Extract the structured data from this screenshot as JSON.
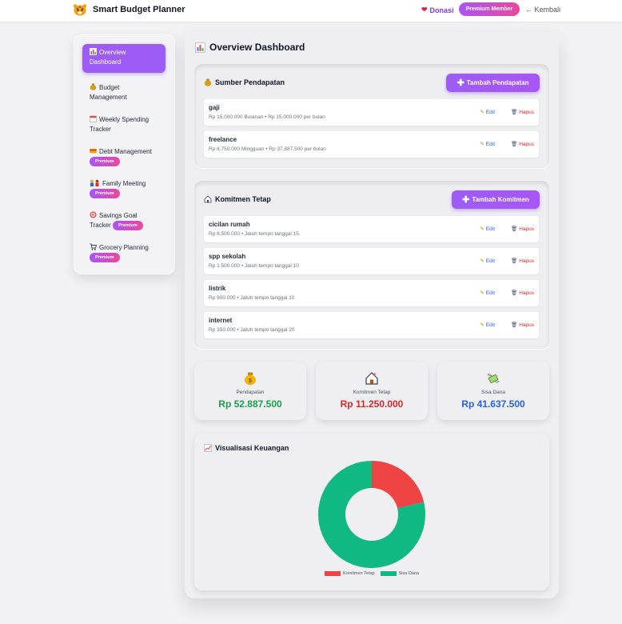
{
  "header": {
    "app_title": "Smart Budget Planner",
    "donasi_label": "Donasi",
    "premium_label": "Premium Member",
    "back_label": "← Kembali"
  },
  "sidebar": {
    "items": [
      {
        "label": "Overview Dashboard",
        "icon": "chart-icon",
        "active": true
      },
      {
        "label": "Budget Management",
        "icon": "money-bag-icon"
      },
      {
        "label": "Weekly Spending Tracker",
        "icon": "calendar-icon"
      },
      {
        "label": "Debt Management",
        "icon": "credit-card-icon",
        "badge": "Premium"
      },
      {
        "label": "Family Meeting",
        "icon": "family-icon",
        "badge": "Premium"
      },
      {
        "label": "Savings Goal Tracker",
        "icon": "target-icon",
        "badge": "Premium"
      },
      {
        "label": "Grocery Planning",
        "icon": "cart-icon",
        "badge": "Premium"
      }
    ]
  },
  "main": {
    "title": "Overview Dashboard",
    "income": {
      "title": "Sumber Pendapatan",
      "add_label": "Tambah Pendapatan",
      "rows": [
        {
          "name": "gaji",
          "detail": "Rp 15.000.000 Bulanan • Rp 15.000.000 per bulan"
        },
        {
          "name": "freelance",
          "detail": "Rp 8.750.000 Mingguan • Rp 37.887.500 per bulan"
        }
      ]
    },
    "commitments": {
      "title": "Komitmen Tetap",
      "add_label": "Tambah Komitmen",
      "rows": [
        {
          "name": "cicilan rumah",
          "detail": "Rp 8.500.000 • Jatuh tempo tanggal 15"
        },
        {
          "name": "spp sekolah",
          "detail": "Rp 1.500.000 • Jatuh tempo tanggal 10"
        },
        {
          "name": "listrik",
          "detail": "Rp 900.000 • Jatuh tempo tanggal 10"
        },
        {
          "name": "internet",
          "detail": "Rp 350.000 • Jatuh tempo tanggal 20"
        }
      ]
    },
    "edit_label": "Edit",
    "delete_label": "Hapus",
    "stats": [
      {
        "label": "Pendapatan",
        "value": "Rp 52.887.500",
        "color": "#16a34a",
        "icon": "money-bag-icon"
      },
      {
        "label": "Komitmen Tetap",
        "value": "Rp 11.250.000",
        "color": "#dc2626",
        "icon": "house-icon"
      },
      {
        "label": "Sisa Dana",
        "value": "Rp 41.637.500",
        "color": "#2563eb",
        "icon": "money-wings-icon"
      }
    ],
    "chart_title": "Visualisasi Keuangan"
  },
  "chart_data": {
    "type": "pie",
    "donut": true,
    "categories": [
      "Komitmen Tetap",
      "Sisa Dana"
    ],
    "values": [
      11250000,
      41637500
    ],
    "colors": [
      "#ef4444",
      "#10b981"
    ],
    "legend_position": "bottom"
  }
}
